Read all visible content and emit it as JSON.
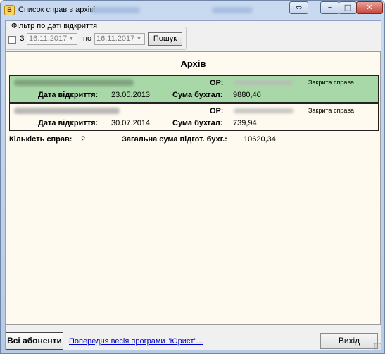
{
  "window": {
    "title": "Список справ в архіві",
    "app_icon_letter": "В",
    "controls": {
      "swap": "⇔",
      "minimize": "–",
      "maximize": "□",
      "close": "✕"
    }
  },
  "filter": {
    "legend": "Фільтр по даті відкриття",
    "from_label": "З",
    "from_date": "16.11.2017",
    "to_label": "по",
    "to_date": "16.11.2017",
    "search_label": "Пошук",
    "enabled": false
  },
  "archive": {
    "title": "Архів",
    "cases": [
      {
        "op_label": "ОР:",
        "status": "Закрита справа",
        "open_date_label": "Дата відкриття:",
        "open_date": "23.05.2013",
        "sum_label": "Сума бухгал:",
        "sum": "9880,40",
        "selected": true
      },
      {
        "op_label": "ОР:",
        "status": "Закрита справа",
        "open_date_label": "Дата відкриття:",
        "open_date": "30.07.2014",
        "sum_label": "Сума бухгал:",
        "sum": "739,94",
        "selected": false
      }
    ],
    "summary": {
      "count_label": "Кількість справ:",
      "count": "2",
      "total_label": "Загальна сума підгот. бухг.:",
      "total": "10620,34"
    }
  },
  "footer": {
    "all_subscribers_label": "Всі абоненти",
    "prev_version_link": "Попередня весія програми \"Юрист\"...",
    "exit_label": "Вихід"
  },
  "colors": {
    "selected_row": "#a8d8a8",
    "panel_bg": "#fffaf0",
    "link": "#0000cc"
  }
}
